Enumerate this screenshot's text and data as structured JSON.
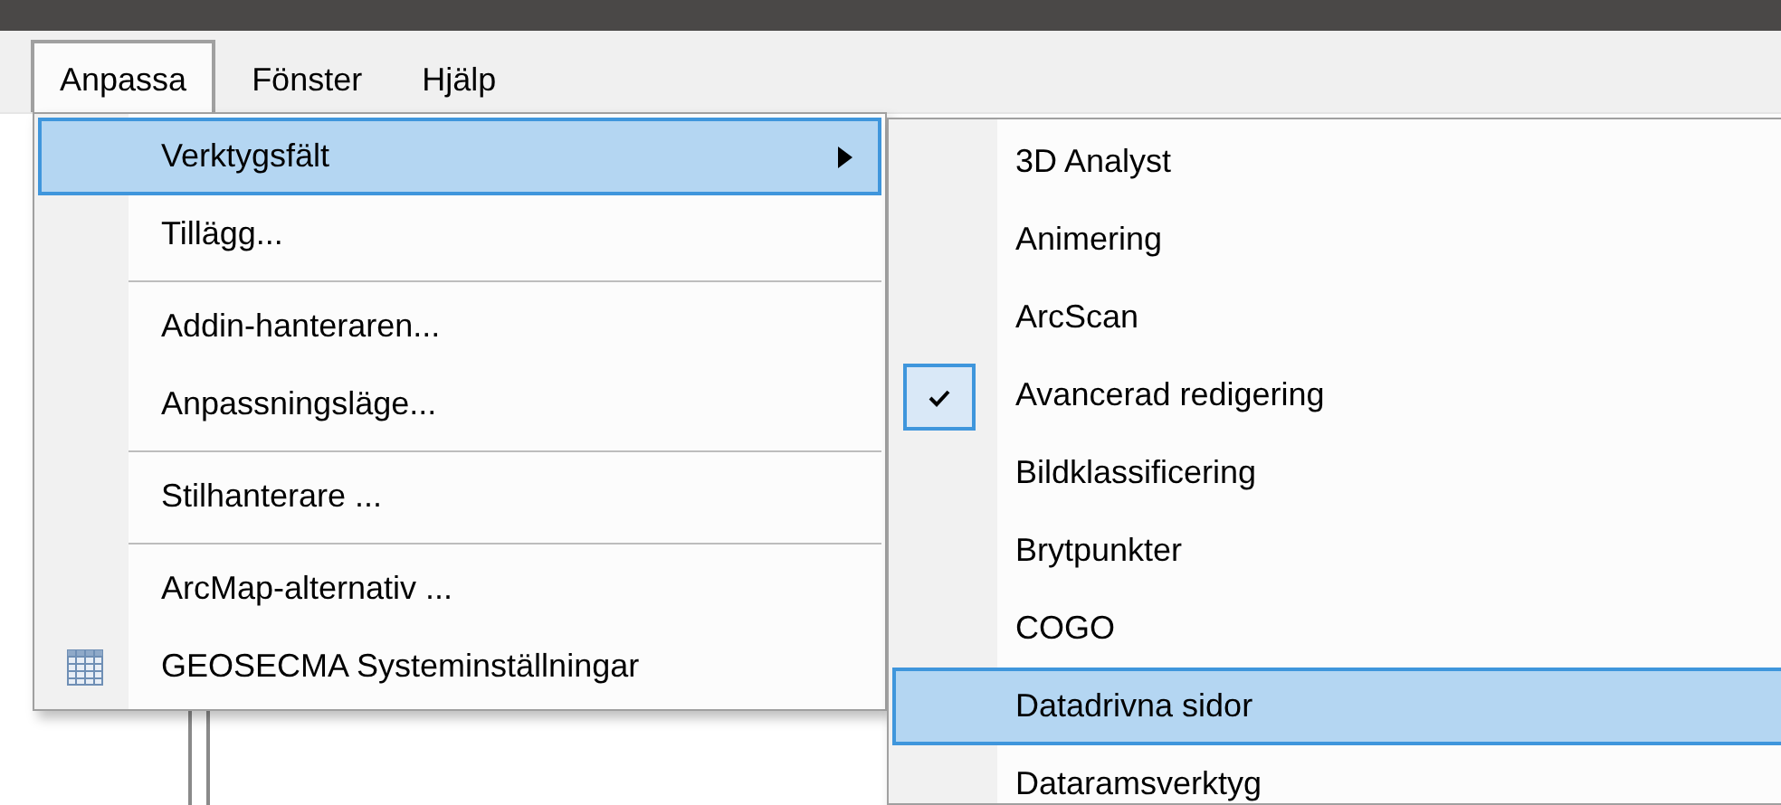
{
  "menubar": [
    {
      "label": "Anpassa",
      "selected": true
    },
    {
      "label": "Fönster",
      "selected": false
    },
    {
      "label": "Hjälp",
      "selected": false
    }
  ],
  "menu": {
    "items": [
      {
        "kind": "submenu",
        "label": "Verktygsfält",
        "highlighted": true
      },
      {
        "kind": "item",
        "label": "Tillägg...",
        "highlighted": false
      },
      {
        "kind": "separator"
      },
      {
        "kind": "item",
        "label": "Addin-hanteraren...",
        "highlighted": false
      },
      {
        "kind": "item",
        "label": "Anpassningsläge...",
        "highlighted": false
      },
      {
        "kind": "separator"
      },
      {
        "kind": "item",
        "label": "Stilhanterare ...",
        "highlighted": false
      },
      {
        "kind": "separator"
      },
      {
        "kind": "item",
        "label": "ArcMap-alternativ ...",
        "highlighted": false
      },
      {
        "kind": "icon_item",
        "label": "GEOSECMA Systeminställningar",
        "highlighted": false
      }
    ]
  },
  "submenu": {
    "items": [
      {
        "label": "3D Analyst",
        "checked": false,
        "highlighted": false
      },
      {
        "label": "Animering",
        "checked": false,
        "highlighted": false
      },
      {
        "label": "ArcScan",
        "checked": false,
        "highlighted": false
      },
      {
        "label": "Avancerad redigering",
        "checked": true,
        "highlighted": false
      },
      {
        "label": "Bildklassificering",
        "checked": false,
        "highlighted": false
      },
      {
        "label": "Brytpunkter",
        "checked": false,
        "highlighted": false
      },
      {
        "label": "COGO",
        "checked": false,
        "highlighted": false
      },
      {
        "label": "Datadrivna sidor",
        "checked": false,
        "highlighted": true
      },
      {
        "label": "Dataramsverktyg",
        "checked": false,
        "highlighted": false
      }
    ]
  }
}
